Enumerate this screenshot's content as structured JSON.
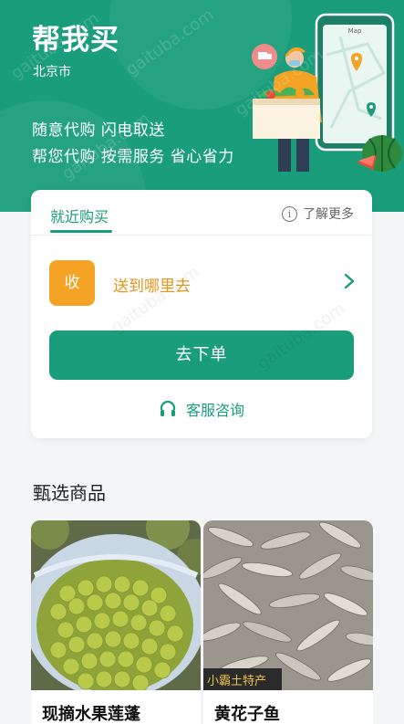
{
  "header": {
    "title": "帮我买",
    "city": "北京市",
    "slogan1": "随意代购 闪电取送",
    "slogan2": "帮您代购 按需服务 省心省力",
    "phone_label": "Map"
  },
  "card": {
    "tab_label": "就近购买",
    "learn_more": "了解更多",
    "receive_badge": "收",
    "destination_prompt": "送到哪里去",
    "order_button": "去下单",
    "customer_service": "客服咨询"
  },
  "section": {
    "title": "甄选商品"
  },
  "products": [
    {
      "name": "现摘水果莲蓬"
    },
    {
      "name": "黄花子鱼",
      "stamp_text": "小霸土特产"
    }
  ],
  "watermark": "gaituba.com",
  "colors": {
    "brand_green": "#1a9d7a",
    "accent_orange": "#f4a324",
    "destination_text": "#e9961c"
  }
}
